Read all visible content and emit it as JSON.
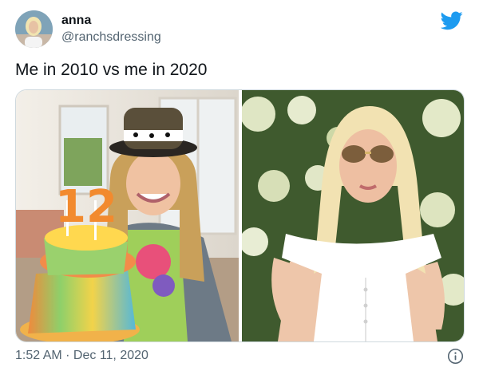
{
  "tweet": {
    "display_name": "anna",
    "handle": "@ranchsdressing",
    "text": "Me in 2010 vs me in 2020",
    "time": "1:52 AM",
    "separator": " · ",
    "date": "Dec 11, 2020"
  },
  "media": {
    "left_candle_text": "12"
  },
  "icons": {
    "brand": "twitter-bird-icon",
    "info": "info-icon"
  },
  "colors": {
    "brand_blue": "#1d9bf0",
    "secondary_text": "#536471",
    "primary_text": "#0f1419"
  }
}
